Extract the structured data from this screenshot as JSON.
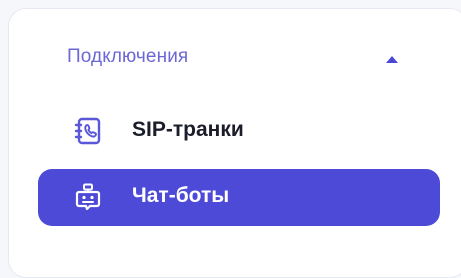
{
  "section": {
    "title": "Подключения",
    "expanded_icon": "chevron-up-icon"
  },
  "nav": {
    "items": [
      {
        "label": "SIP-транки",
        "icon": "phone-book-icon",
        "active": false
      },
      {
        "label": "Чат-боты",
        "icon": "chatbot-icon",
        "active": true
      }
    ]
  },
  "colors": {
    "accent": "#4d4ad8",
    "section_title": "#6b68d6",
    "icon": "#5a57d9",
    "text": "#1b1d2b",
    "active_text": "#ffffff"
  }
}
